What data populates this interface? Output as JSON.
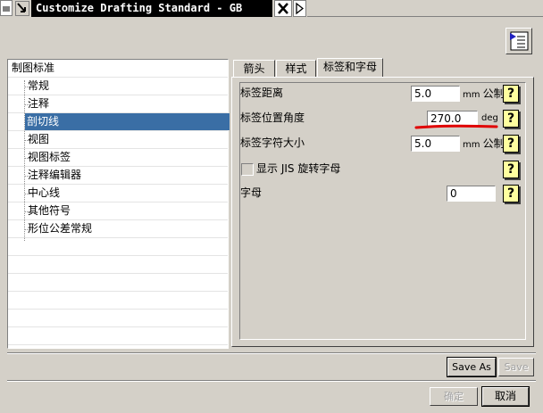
{
  "window": {
    "title": "Customize Drafting Standard - GB"
  },
  "tree": {
    "items": [
      {
        "label": "制图标准"
      },
      {
        "label": "常规"
      },
      {
        "label": "注释"
      },
      {
        "label": "剖切线"
      },
      {
        "label": "视图"
      },
      {
        "label": "视图标签"
      },
      {
        "label": "注释编辑器"
      },
      {
        "label": "中心线"
      },
      {
        "label": "其他符号"
      },
      {
        "label": "形位公差常规"
      }
    ],
    "selected": "剖切线"
  },
  "tabs": [
    {
      "label": "箭头"
    },
    {
      "label": "样式"
    },
    {
      "label": "标签和字母"
    }
  ],
  "active_tab": "标签和字母",
  "form": {
    "label_distance": {
      "label": "标签距离",
      "value": "5.0",
      "unit_small": "mm",
      "unit_tail": "公制"
    },
    "label_angle": {
      "label": "标签位置角度",
      "value": "270.0",
      "unit_small": "deg"
    },
    "label_size": {
      "label": "标签字符大小",
      "value": "5.0",
      "unit_small": "mm",
      "unit_tail": "公制"
    },
    "jis_rotate": {
      "label": "显示 JIS 旋转字母",
      "checked": false
    },
    "letter": {
      "label": "字母",
      "value": "0"
    },
    "help_glyph": "?"
  },
  "buttons": {
    "save_as": "Save As",
    "save": "Save",
    "ok": "确定",
    "cancel": "取消"
  },
  "colors": {
    "annotation_red": "#e00000",
    "selection_blue": "#3a6ea5"
  }
}
